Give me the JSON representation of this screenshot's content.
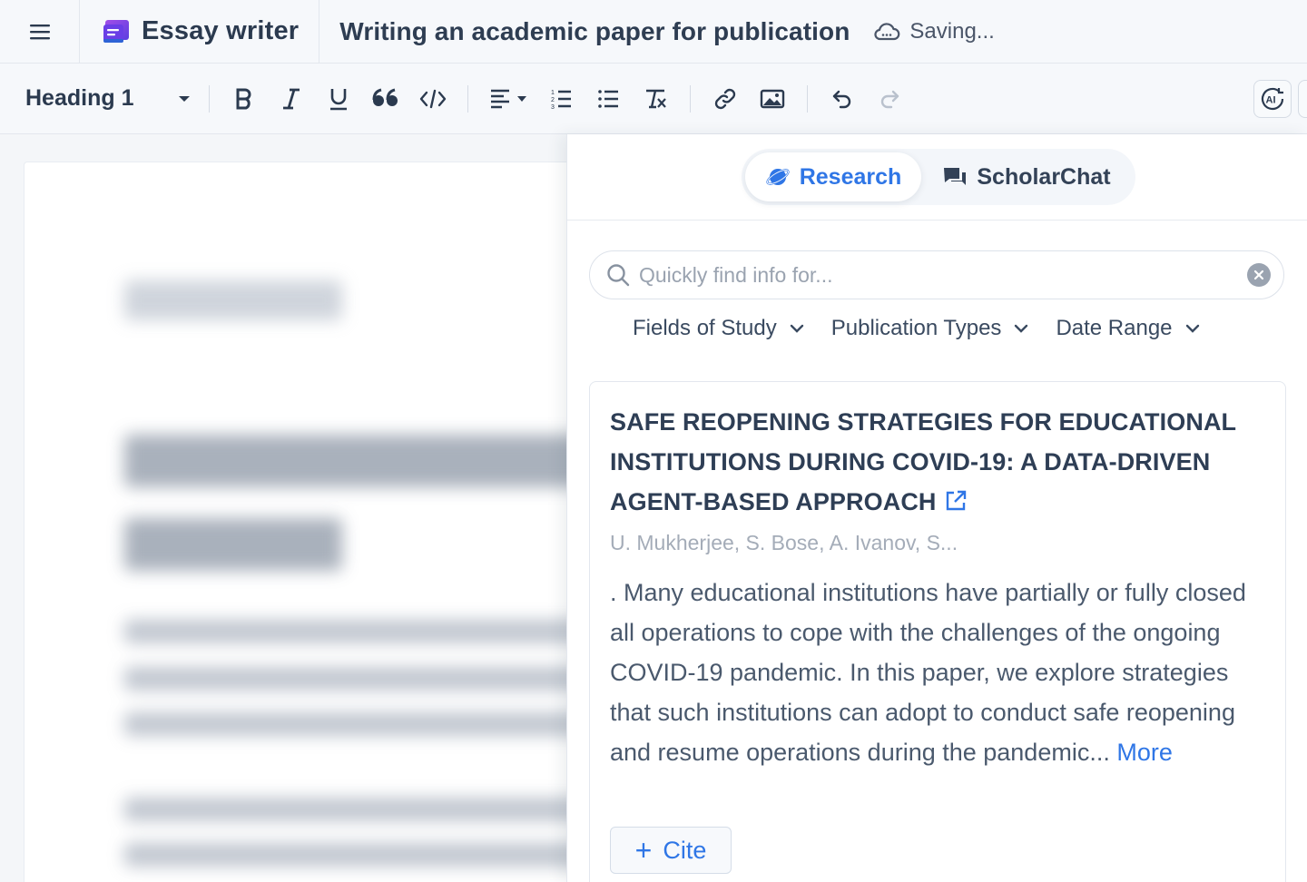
{
  "app": {
    "brand_name": "Essay writer",
    "doc_title": "Writing an academic paper for publication",
    "save_status": "Saving..."
  },
  "toolbar": {
    "heading_style": "Heading 1",
    "buttons": [
      "bold-icon",
      "italic-icon",
      "underline-icon",
      "quote-icon",
      "code-icon",
      "align-left-icon",
      "ordered-list-icon",
      "bullet-list-icon",
      "clear-format-icon",
      "link-icon",
      "image-icon",
      "undo-icon",
      "redo-icon"
    ],
    "ai_label": "AI"
  },
  "panel": {
    "tabs": [
      {
        "label": "Research",
        "active": true
      },
      {
        "label": "ScholarChat",
        "active": false
      }
    ],
    "search": {
      "placeholder": "Quickly find info for...",
      "value": ""
    },
    "filters": [
      {
        "label": "Fields of Study"
      },
      {
        "label": "Publication Types"
      },
      {
        "label": "Date Range"
      }
    ],
    "results": [
      {
        "title": "SAFE REOPENING STRATEGIES FOR EDUCATIONAL INSTITUTIONS DURING COVID-19: A DATA-DRIVEN AGENT-BASED APPROACH",
        "authors": "U. Mukherjee, S. Bose, A. Ivanov, S...",
        "abstract": ". Many educational institutions have partially or fully closed all operations to cope with the challenges of the ongoing COVID-19 pandemic. In this paper, we explore strategies that such institutions can adopt to conduct safe reopening and resume operations during the pandemic...",
        "more_label": "More",
        "cite_label": "Cite"
      }
    ]
  },
  "colors": {
    "accent": "#2f76e6",
    "brand_purple": "#7b3fe4",
    "text_dark": "#2b3a4f"
  }
}
